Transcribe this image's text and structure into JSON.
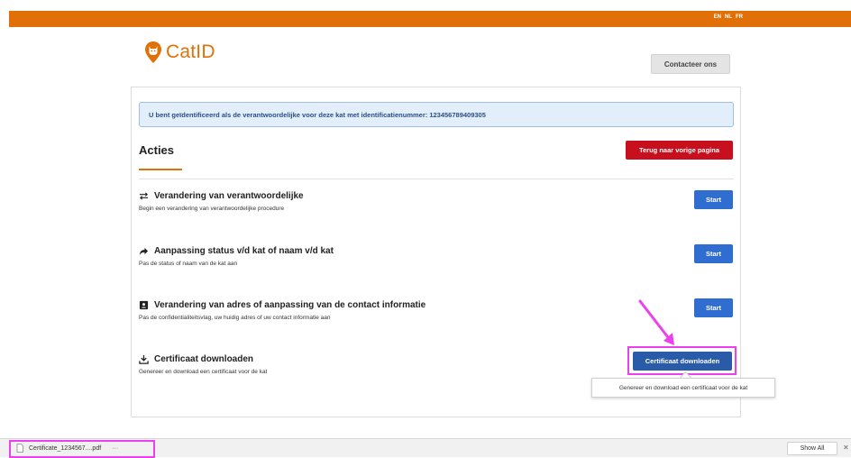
{
  "header": {
    "languages": [
      "EN",
      "NL",
      "FR"
    ],
    "brand": "CatID",
    "contact_label": "Contacteer ons",
    "accent_color": "#e07007"
  },
  "alert": {
    "text": "U bent geïdentificeerd als de verantwoordelijke voor deze kat met identificatienummer: 123456789409305"
  },
  "actions_section": {
    "title": "Acties",
    "back_label": "Terug naar vorige pagina"
  },
  "actions": [
    {
      "icon": "swap-arrows-icon",
      "title": "Verandering van verantwoordelijke",
      "description": "Begin een verandering van verantwoordelijke procedure",
      "button": "Start"
    },
    {
      "icon": "share-arrow-icon",
      "title": "Aanpassing status v/d kat of naam v/d kat",
      "description": "Pas de status of naam van de kat aan",
      "button": "Start"
    },
    {
      "icon": "contact-card-icon",
      "title": "Verandering van adres of aanpassing van de contact informatie",
      "description": "Pas de confidentialiteitsvlag, uw huidig adres of uw contact informatie aan",
      "button": "Start"
    },
    {
      "icon": "download-icon",
      "title": "Certificaat downloaden",
      "description": "Genereer en download een certificaat voor de kat",
      "button": "Certificaat downloaden"
    }
  ],
  "tooltip": {
    "text": "Genereer en download een certificaat voor de kat"
  },
  "download_bar": {
    "file_name": "Certificate_1234567....pdf",
    "more": "···",
    "show_all": "Show All",
    "close": "✕"
  }
}
